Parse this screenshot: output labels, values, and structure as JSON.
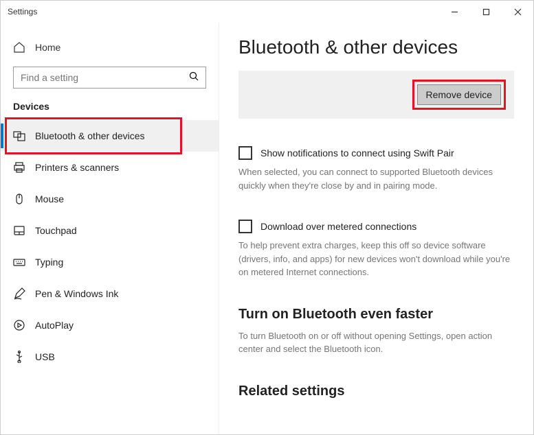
{
  "window": {
    "title": "Settings"
  },
  "sidebar": {
    "home_label": "Home",
    "search_placeholder": "Find a setting",
    "section_label": "Devices",
    "items": [
      {
        "label": "Bluetooth & other devices",
        "active": true
      },
      {
        "label": "Printers & scanners"
      },
      {
        "label": "Mouse"
      },
      {
        "label": "Touchpad"
      },
      {
        "label": "Typing"
      },
      {
        "label": "Pen & Windows Ink"
      },
      {
        "label": "AutoPlay"
      },
      {
        "label": "USB"
      }
    ]
  },
  "main": {
    "heading": "Bluetooth & other devices",
    "remove_button": "Remove device",
    "swift_pair_label": "Show notifications to connect using Swift Pair",
    "swift_pair_help": "When selected, you can connect to supported Bluetooth devices quickly when they're close by and in pairing mode.",
    "metered_label": "Download over metered connections",
    "metered_help": "To help prevent extra charges, keep this off so device software (drivers, info, and apps) for new devices won't download while you're on metered Internet connections.",
    "faster_head": "Turn on Bluetooth even faster",
    "faster_help": "To turn Bluetooth on or off without opening Settings, open action center and select the Bluetooth icon.",
    "related_head": "Related settings"
  }
}
